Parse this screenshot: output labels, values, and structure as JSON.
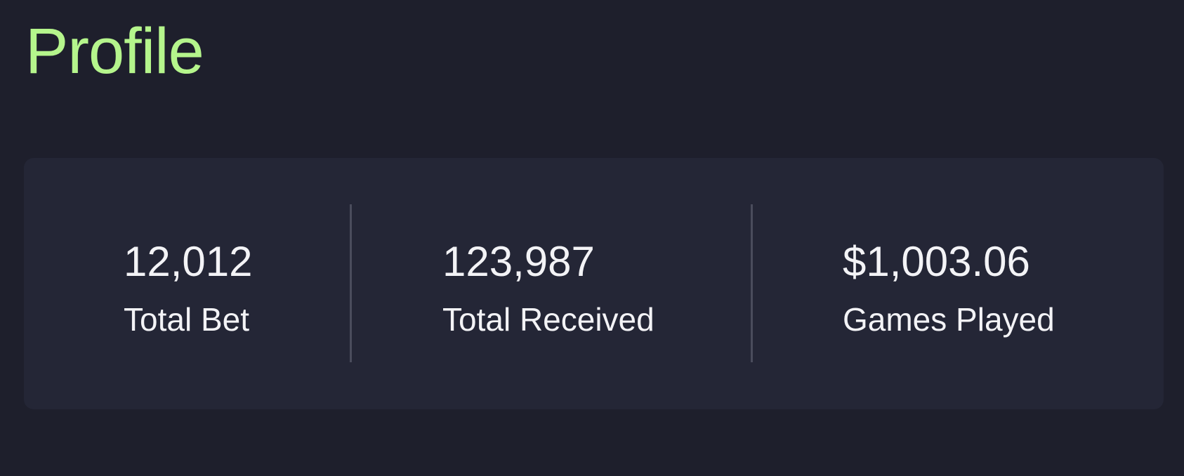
{
  "page": {
    "title": "Profile",
    "accent_color": "#b5f58c",
    "background_color": "#1e1f2c",
    "card_color": "#242636"
  },
  "stats": [
    {
      "value": "12,012",
      "label": "Total Bet"
    },
    {
      "value": "123,987",
      "label": "Total Received"
    },
    {
      "value": "$1,003.06",
      "label": "Games Played"
    }
  ]
}
